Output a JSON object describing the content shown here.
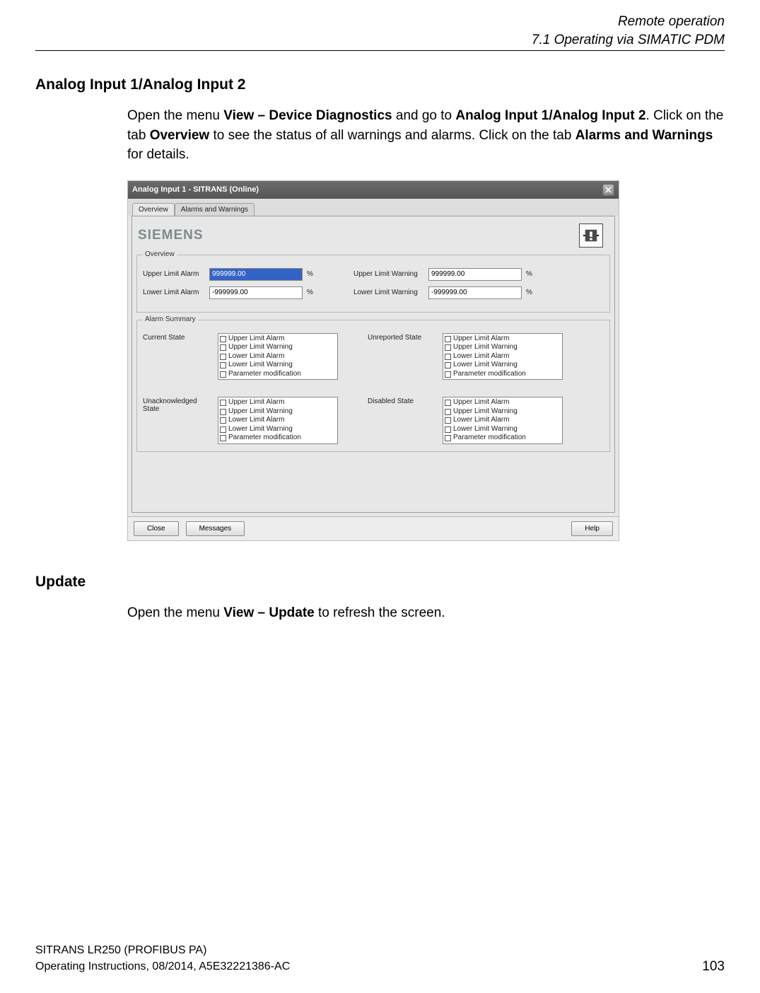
{
  "header": {
    "line1": "Remote operation",
    "line2": "7.1 Operating via SIMATIC PDM"
  },
  "section1": {
    "heading": "Analog Input 1/Analog Input 2",
    "para": {
      "t1": "Open the menu ",
      "b1": "View – Device Diagnostics",
      "t2": " and go to ",
      "b2": "Analog Input 1/Analog Input 2",
      "t3": ". Click on the tab ",
      "b3": "Overview",
      "t4": " to see the status of all warnings and alarms. Click on the tab ",
      "b4": "Alarms and Warnings",
      "t5": " for details."
    }
  },
  "dialog": {
    "title": "Analog Input 1 - SITRANS  (Online)",
    "tabs": {
      "overview": "Overview",
      "alarms": "Alarms and Warnings"
    },
    "brand": "SIEMENS",
    "overview": {
      "legend": "Overview",
      "row1": {
        "l1": "Upper Limit Alarm",
        "v1": "999999.00",
        "u1": "%",
        "l2": "Upper Limit Warning",
        "v2": "999999.00",
        "u2": "%"
      },
      "row2": {
        "l1": "Lower Limit Alarm",
        "v1": "-999999.00",
        "u1": "%",
        "l2": "Lower Limit Warning",
        "v2": "-999999.00",
        "u2": "%"
      }
    },
    "alarmSummary": {
      "legend": "Alarm Summary",
      "labels": {
        "current": "Current State",
        "unreported": "Unreported State",
        "unack": "Unacknowledged State",
        "disabled": "Disabled State"
      },
      "items": [
        "Upper Limit Alarm",
        "Upper Limit Warning",
        "Lower Limit Alarm",
        "Lower Limit Warning",
        "Parameter modification"
      ]
    },
    "buttons": {
      "close": "Close",
      "messages": "Messages",
      "help": "Help"
    }
  },
  "section2": {
    "heading": "Update",
    "para": {
      "t1": "Open the menu ",
      "b1": "View – Update",
      "t2": " to refresh the screen."
    }
  },
  "footer": {
    "l1": "SITRANS LR250 (PROFIBUS PA)",
    "l2": "Operating Instructions, 08/2014, A5E32221386-AC",
    "page": "103"
  }
}
